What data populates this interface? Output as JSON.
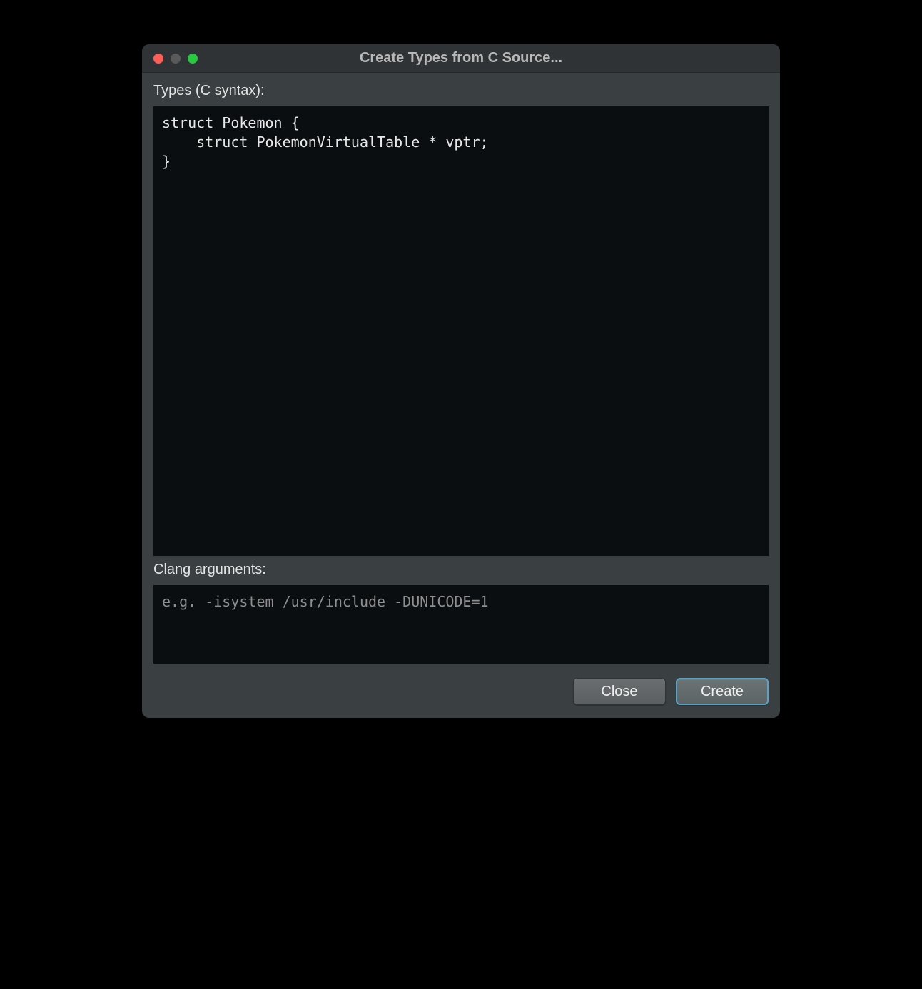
{
  "window": {
    "title": "Create Types from C Source..."
  },
  "types": {
    "label": "Types (C syntax):",
    "value": "struct Pokemon {\n    struct PokemonVirtualTable * vptr;\n}"
  },
  "clang": {
    "label": "Clang arguments:",
    "placeholder": "e.g. -isystem /usr/include -DUNICODE=1",
    "value": ""
  },
  "buttons": {
    "close": "Close",
    "create": "Create"
  }
}
